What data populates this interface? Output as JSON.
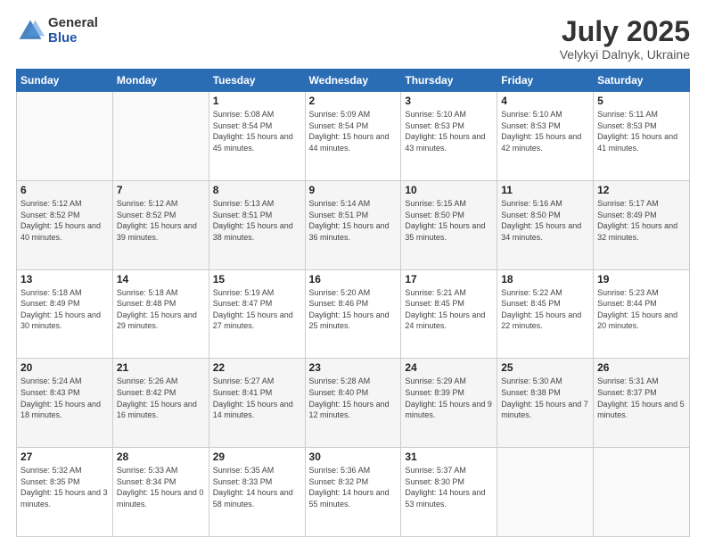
{
  "logo": {
    "general": "General",
    "blue": "Blue"
  },
  "title": {
    "month": "July 2025",
    "location": "Velykyi Dalnyk, Ukraine"
  },
  "weekdays": [
    "Sunday",
    "Monday",
    "Tuesday",
    "Wednesday",
    "Thursday",
    "Friday",
    "Saturday"
  ],
  "weeks": [
    [
      {
        "day": null
      },
      {
        "day": null
      },
      {
        "day": "1",
        "sunrise": "Sunrise: 5:08 AM",
        "sunset": "Sunset: 8:54 PM",
        "daylight": "Daylight: 15 hours and 45 minutes."
      },
      {
        "day": "2",
        "sunrise": "Sunrise: 5:09 AM",
        "sunset": "Sunset: 8:54 PM",
        "daylight": "Daylight: 15 hours and 44 minutes."
      },
      {
        "day": "3",
        "sunrise": "Sunrise: 5:10 AM",
        "sunset": "Sunset: 8:53 PM",
        "daylight": "Daylight: 15 hours and 43 minutes."
      },
      {
        "day": "4",
        "sunrise": "Sunrise: 5:10 AM",
        "sunset": "Sunset: 8:53 PM",
        "daylight": "Daylight: 15 hours and 42 minutes."
      },
      {
        "day": "5",
        "sunrise": "Sunrise: 5:11 AM",
        "sunset": "Sunset: 8:53 PM",
        "daylight": "Daylight: 15 hours and 41 minutes."
      }
    ],
    [
      {
        "day": "6",
        "sunrise": "Sunrise: 5:12 AM",
        "sunset": "Sunset: 8:52 PM",
        "daylight": "Daylight: 15 hours and 40 minutes."
      },
      {
        "day": "7",
        "sunrise": "Sunrise: 5:12 AM",
        "sunset": "Sunset: 8:52 PM",
        "daylight": "Daylight: 15 hours and 39 minutes."
      },
      {
        "day": "8",
        "sunrise": "Sunrise: 5:13 AM",
        "sunset": "Sunset: 8:51 PM",
        "daylight": "Daylight: 15 hours and 38 minutes."
      },
      {
        "day": "9",
        "sunrise": "Sunrise: 5:14 AM",
        "sunset": "Sunset: 8:51 PM",
        "daylight": "Daylight: 15 hours and 36 minutes."
      },
      {
        "day": "10",
        "sunrise": "Sunrise: 5:15 AM",
        "sunset": "Sunset: 8:50 PM",
        "daylight": "Daylight: 15 hours and 35 minutes."
      },
      {
        "day": "11",
        "sunrise": "Sunrise: 5:16 AM",
        "sunset": "Sunset: 8:50 PM",
        "daylight": "Daylight: 15 hours and 34 minutes."
      },
      {
        "day": "12",
        "sunrise": "Sunrise: 5:17 AM",
        "sunset": "Sunset: 8:49 PM",
        "daylight": "Daylight: 15 hours and 32 minutes."
      }
    ],
    [
      {
        "day": "13",
        "sunrise": "Sunrise: 5:18 AM",
        "sunset": "Sunset: 8:49 PM",
        "daylight": "Daylight: 15 hours and 30 minutes."
      },
      {
        "day": "14",
        "sunrise": "Sunrise: 5:18 AM",
        "sunset": "Sunset: 8:48 PM",
        "daylight": "Daylight: 15 hours and 29 minutes."
      },
      {
        "day": "15",
        "sunrise": "Sunrise: 5:19 AM",
        "sunset": "Sunset: 8:47 PM",
        "daylight": "Daylight: 15 hours and 27 minutes."
      },
      {
        "day": "16",
        "sunrise": "Sunrise: 5:20 AM",
        "sunset": "Sunset: 8:46 PM",
        "daylight": "Daylight: 15 hours and 25 minutes."
      },
      {
        "day": "17",
        "sunrise": "Sunrise: 5:21 AM",
        "sunset": "Sunset: 8:45 PM",
        "daylight": "Daylight: 15 hours and 24 minutes."
      },
      {
        "day": "18",
        "sunrise": "Sunrise: 5:22 AM",
        "sunset": "Sunset: 8:45 PM",
        "daylight": "Daylight: 15 hours and 22 minutes."
      },
      {
        "day": "19",
        "sunrise": "Sunrise: 5:23 AM",
        "sunset": "Sunset: 8:44 PM",
        "daylight": "Daylight: 15 hours and 20 minutes."
      }
    ],
    [
      {
        "day": "20",
        "sunrise": "Sunrise: 5:24 AM",
        "sunset": "Sunset: 8:43 PM",
        "daylight": "Daylight: 15 hours and 18 minutes."
      },
      {
        "day": "21",
        "sunrise": "Sunrise: 5:26 AM",
        "sunset": "Sunset: 8:42 PM",
        "daylight": "Daylight: 15 hours and 16 minutes."
      },
      {
        "day": "22",
        "sunrise": "Sunrise: 5:27 AM",
        "sunset": "Sunset: 8:41 PM",
        "daylight": "Daylight: 15 hours and 14 minutes."
      },
      {
        "day": "23",
        "sunrise": "Sunrise: 5:28 AM",
        "sunset": "Sunset: 8:40 PM",
        "daylight": "Daylight: 15 hours and 12 minutes."
      },
      {
        "day": "24",
        "sunrise": "Sunrise: 5:29 AM",
        "sunset": "Sunset: 8:39 PM",
        "daylight": "Daylight: 15 hours and 9 minutes."
      },
      {
        "day": "25",
        "sunrise": "Sunrise: 5:30 AM",
        "sunset": "Sunset: 8:38 PM",
        "daylight": "Daylight: 15 hours and 7 minutes."
      },
      {
        "day": "26",
        "sunrise": "Sunrise: 5:31 AM",
        "sunset": "Sunset: 8:37 PM",
        "daylight": "Daylight: 15 hours and 5 minutes."
      }
    ],
    [
      {
        "day": "27",
        "sunrise": "Sunrise: 5:32 AM",
        "sunset": "Sunset: 8:35 PM",
        "daylight": "Daylight: 15 hours and 3 minutes."
      },
      {
        "day": "28",
        "sunrise": "Sunrise: 5:33 AM",
        "sunset": "Sunset: 8:34 PM",
        "daylight": "Daylight: 15 hours and 0 minutes."
      },
      {
        "day": "29",
        "sunrise": "Sunrise: 5:35 AM",
        "sunset": "Sunset: 8:33 PM",
        "daylight": "Daylight: 14 hours and 58 minutes."
      },
      {
        "day": "30",
        "sunrise": "Sunrise: 5:36 AM",
        "sunset": "Sunset: 8:32 PM",
        "daylight": "Daylight: 14 hours and 55 minutes."
      },
      {
        "day": "31",
        "sunrise": "Sunrise: 5:37 AM",
        "sunset": "Sunset: 8:30 PM",
        "daylight": "Daylight: 14 hours and 53 minutes."
      },
      {
        "day": null
      },
      {
        "day": null
      }
    ]
  ]
}
